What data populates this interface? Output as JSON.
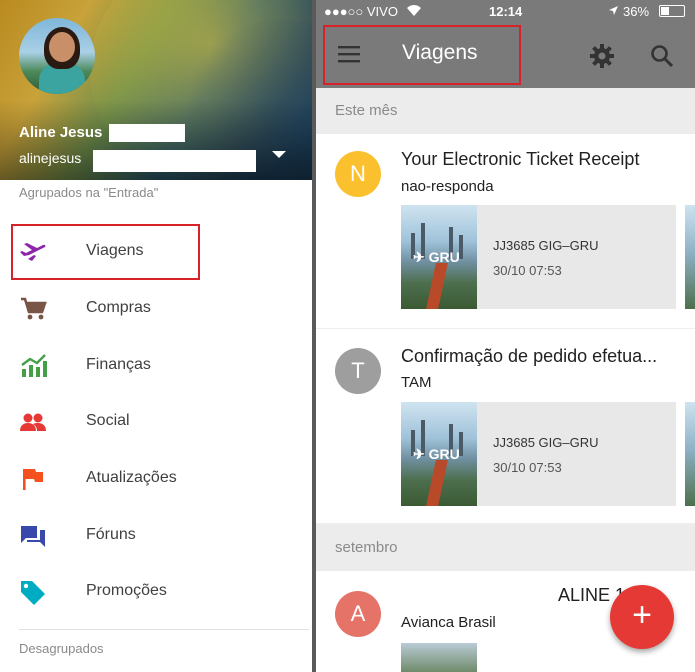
{
  "drawer": {
    "user_name": "Aline Jesus",
    "user_email": "alinejesus",
    "group_label": "Agrupados na \"Entrada\"",
    "items": [
      {
        "label": "Viagens",
        "icon": "airplane-icon",
        "color": "#8e24aa"
      },
      {
        "label": "Compras",
        "icon": "cart-icon",
        "color": "#795548"
      },
      {
        "label": "Finanças",
        "icon": "chart-icon",
        "color": "#43a047"
      },
      {
        "label": "Social",
        "icon": "people-icon",
        "color": "#e53935"
      },
      {
        "label": "Atualizações",
        "icon": "flag-icon",
        "color": "#f4511e"
      },
      {
        "label": "Fóruns",
        "icon": "forum-icon",
        "color": "#3949ab"
      },
      {
        "label": "Promoções",
        "icon": "tag-icon",
        "color": "#00acc1"
      }
    ],
    "ungrouped_label": "Desagrupados"
  },
  "status_bar": {
    "carrier": "●●●○○ VIVO",
    "time": "12:14",
    "battery": "36%"
  },
  "toolbar": {
    "title": "Viagens"
  },
  "sections": [
    {
      "label": "Este mês"
    },
    {
      "label": "setembro"
    }
  ],
  "emails": [
    {
      "letter": "N",
      "avatar_color": "#fbc02d",
      "subject": "Your Electronic Ticket Receipt",
      "sender": "nao-responda",
      "flight_badge": "GRU",
      "flight_code": "JJ3685 GIG–GRU",
      "flight_date": "30/10 07:53"
    },
    {
      "letter": "T",
      "avatar_color": "#9e9e9e",
      "subject": "Confirmação de pedido efetua...",
      "sender": "TAM",
      "flight_badge": "GRU",
      "flight_code": "JJ3685 GIG–GRU",
      "flight_date": "30/10 07:53"
    },
    {
      "letter": "A",
      "avatar_color": "#e57368",
      "subject": "ALINE 1",
      "sender": "Avianca Brasil"
    }
  ],
  "fab": {
    "label": "+"
  },
  "colors": {
    "accent": "#e53935",
    "toolbar": "#7a7a7a",
    "highlight_border": "#d8222a"
  }
}
